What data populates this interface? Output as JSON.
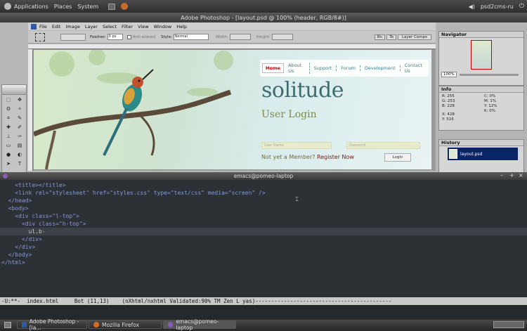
{
  "top_panel": {
    "menus": [
      "Applications",
      "Places",
      "System"
    ],
    "user": "psd2cms-ru"
  },
  "photoshop": {
    "title": "Adobe Photoshop - [layout.psd @ 100% (header, RGB/8#)]",
    "menus": [
      "File",
      "Edit",
      "Image",
      "Layer",
      "Select",
      "Filter",
      "View",
      "Window",
      "Help"
    ],
    "options": {
      "feather_label": "Feather:",
      "feather_value": "0 px",
      "antialias_label": "Anti-aliased",
      "style_label": "Style:",
      "style_value": "Normal",
      "width_label": "Width:",
      "height_label": "Height:",
      "btn_fn": "Bn",
      "btn_to": "To",
      "layer_comps": "Layer Comps"
    },
    "design": {
      "nav": [
        "Home",
        "About Us",
        "Support",
        "Forum",
        "Development",
        "Contact Us"
      ],
      "brand": "solitude",
      "login_title": "User Login",
      "username_placeholder": "User Name",
      "password_placeholder": "Password",
      "member_text": "Not yet a Member?",
      "register_text": "Register Now",
      "login_button": "Login"
    },
    "panels": {
      "navigator": "Navigator",
      "zoom": "100%",
      "info": "Info",
      "info_values": {
        "r": "255",
        "g": "253",
        "b": "228",
        "c": "0%",
        "m": "1%",
        "y": "12%",
        "k": "0%",
        "x": "428",
        "y2": "516"
      },
      "history": "History",
      "history_item": "layout.psd"
    }
  },
  "emacs": {
    "title": "emacs@pomeo-laptop",
    "lines": [
      "    <title></title>",
      "    <link rel=\"stylesheet\" href=\"styles.css\" type=\"text/css\" media=\"screen\" />",
      "  </head>",
      "  <body>",
      "    <div class=\"l-top\">",
      "      <div class=\"h-top\">",
      "        ul.b-",
      "      </div>",
      "    </div>",
      "  </body>",
      "</html>"
    ],
    "modeline": "-U:**-  index.html     Bot (11,13)    (nXhtml/nxhtml Validated:90% TM Zen L yas)-------------------------------------------"
  },
  "taskbar": {
    "tasks": [
      "Adobe Photoshop - [la...",
      "Mozilla Firefox",
      "emacs@pomeo-laptop"
    ]
  }
}
